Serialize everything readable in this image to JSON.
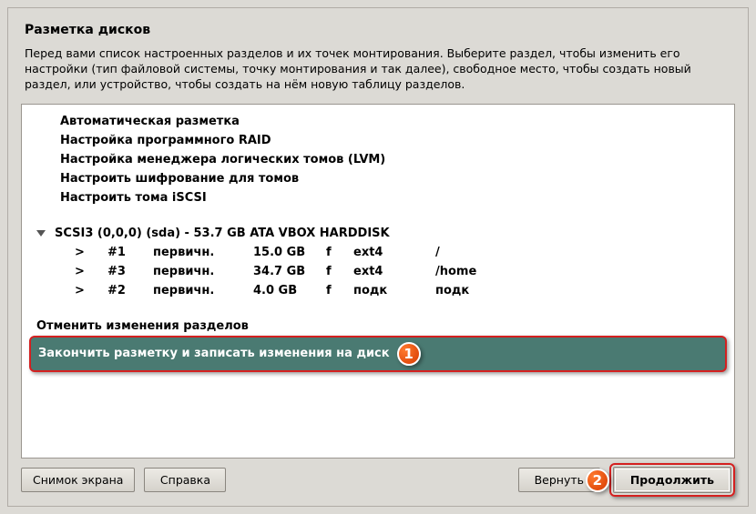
{
  "title": "Разметка дисков",
  "description": "Перед вами список настроенных разделов и их точек монтирования. Выберите раздел, чтобы изменить его настройки (тип файловой системы, точку монтирования и так далее), свободное место, чтобы создать новый раздел, или устройство, чтобы создать на нём новую таблицу разделов.",
  "menu": {
    "auto": "Автоматическая разметка",
    "raid": "Настройка программного RAID",
    "lvm": "Настройка менеджера логических томов (LVM)",
    "crypt": "Настроить шифрование для томов",
    "iscsi": "Настроить тома iSCSI"
  },
  "disk": {
    "label": "SCSI3 (0,0,0) (sda) - 53.7 GB ATA VBOX HARDDISK",
    "parts": [
      {
        "arrow": ">",
        "num": "#1",
        "type": "первичн.",
        "size": "15.0 GB",
        "flag": "f",
        "fs": "ext4",
        "mount": "/"
      },
      {
        "arrow": ">",
        "num": "#3",
        "type": "первичн.",
        "size": "34.7 GB",
        "flag": "f",
        "fs": "ext4",
        "mount": "/home"
      },
      {
        "arrow": ">",
        "num": "#2",
        "type": "первичн.",
        "size": "4.0 GB",
        "flag": "f",
        "fs": "подк",
        "mount": "подк"
      }
    ]
  },
  "undo": "Отменить изменения разделов",
  "finish": "Закончить разметку и записать изменения на диск",
  "badges": {
    "one": "1",
    "two": "2"
  },
  "buttons": {
    "screenshot": "Снимок экрана",
    "help": "Справка",
    "back": "Вернуть",
    "continue": "Продолжить"
  }
}
